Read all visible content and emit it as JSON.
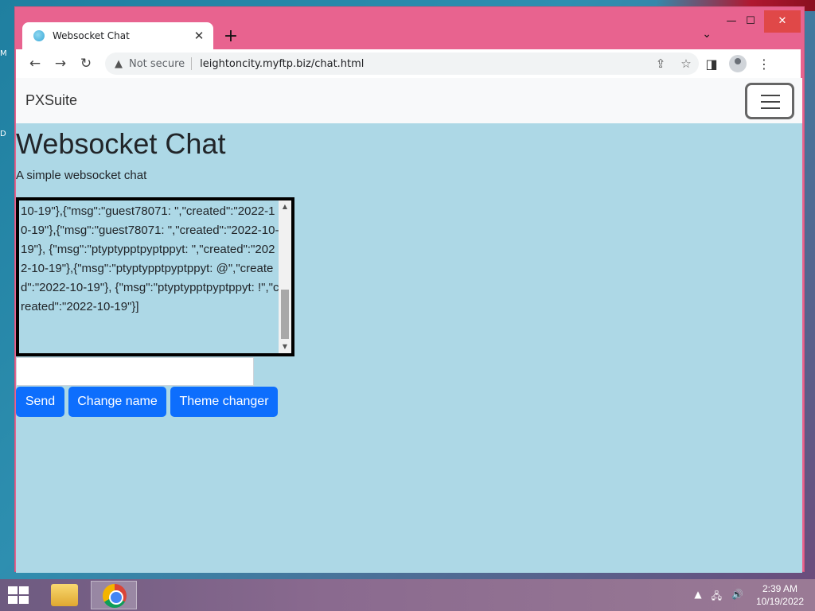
{
  "desktop": {
    "edge_letters": [
      "M",
      "D"
    ]
  },
  "browser": {
    "tab": {
      "title": "Websocket Chat",
      "close_glyph": "✕"
    },
    "new_tab_glyph": "+",
    "tab_search_glyph": "⌄",
    "window_controls": {
      "minimize": "—",
      "maximize": "☐",
      "close": "✕"
    },
    "nav": {
      "back": "←",
      "forward": "→",
      "reload": "↻"
    },
    "address": {
      "security_icon": "▲",
      "security_label": "Not secure",
      "url": "leightoncity.myftp.biz/chat.html",
      "share_glyph": "⇪",
      "star_glyph": "☆"
    },
    "toolbar": {
      "side_panel_glyph": "◨",
      "menu_glyph": "⋮"
    }
  },
  "page": {
    "brand": "PXSuite",
    "title": "Websocket Chat",
    "lead": "A simple websocket chat",
    "chat_log": "10-19\"},{\"msg\":\"guest78071: \",\"created\":\"2022-10-19\"},{\"msg\":\"guest78071: \",\"created\":\"2022-10-19\"}, {\"msg\":\"ptyptypptpyptppyt: \",\"created\":\"2022-10-19\"},{\"msg\":\"ptyptypptpyptppyt: @\",\"created\":\"2022-10-19\"}, {\"msg\":\"ptyptypptpyptppyt: !\",\"created\":\"2022-10-19\"}]",
    "message_value": "",
    "buttons": {
      "send": "Send",
      "change_name": "Change name",
      "theme_changer": "Theme changer"
    },
    "scroll_up_glyph": "▲",
    "scroll_down_glyph": "▼"
  },
  "taskbar": {
    "tray": {
      "chevron": "▲",
      "network": "🖧",
      "volume": "🔊"
    },
    "clock": {
      "time": "2:39 AM",
      "date": "10/19/2022"
    }
  },
  "colors": {
    "page_bg": "#add8e6",
    "primary_button": "#0d6efd",
    "window_frame": "#e8638f"
  }
}
